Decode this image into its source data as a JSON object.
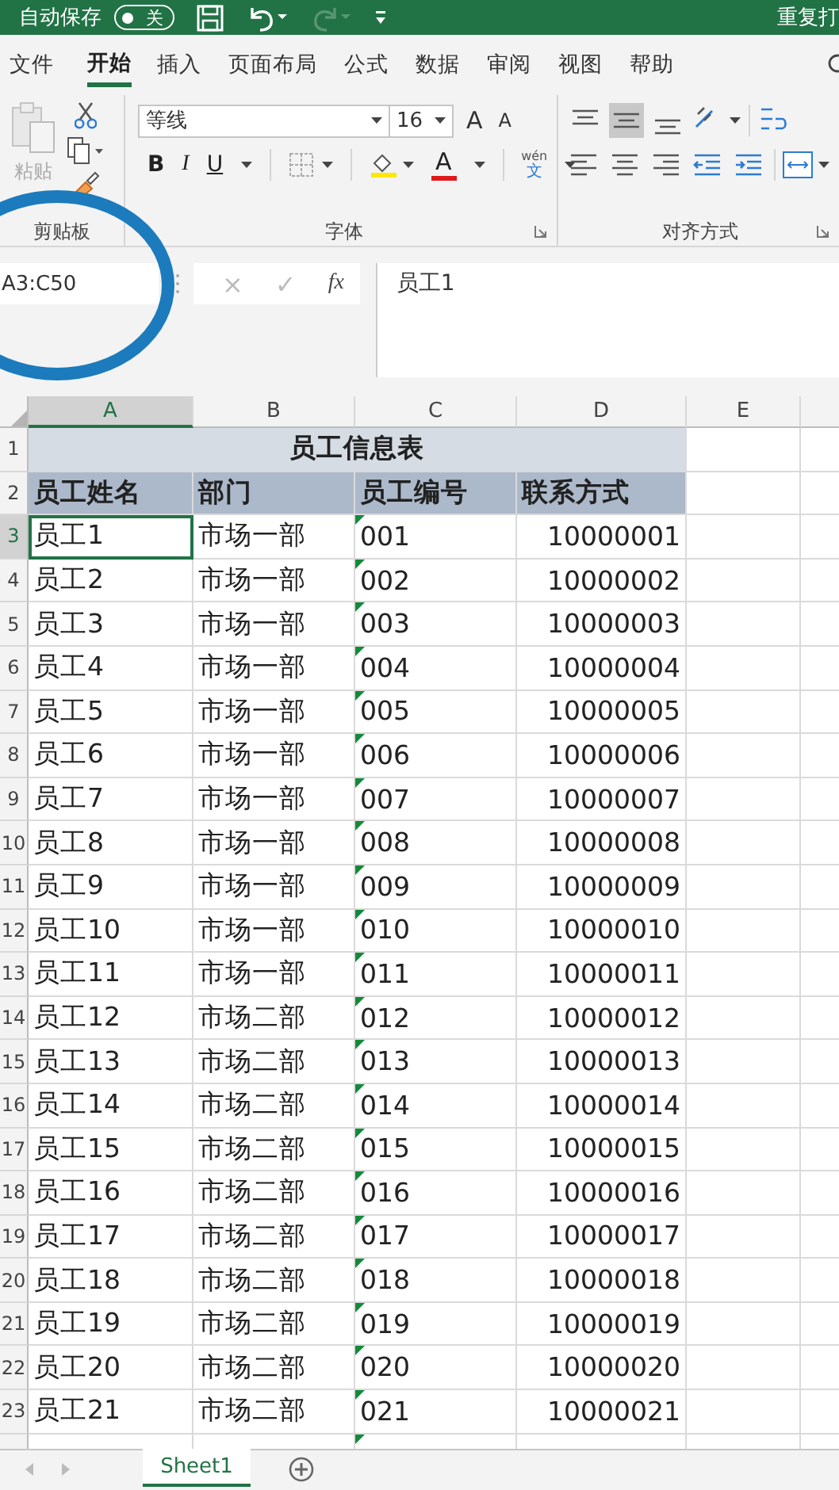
{
  "title_bar": {
    "autosave_label": "自动保存",
    "autosave_toggle": {
      "on": false,
      "label": "关"
    },
    "document_title": "重复打"
  },
  "ribbon_tabs": [
    {
      "label": "文件",
      "selected": false
    },
    {
      "label": "开始",
      "selected": true
    },
    {
      "label": "插入",
      "selected": false
    },
    {
      "label": "页面布局",
      "selected": false
    },
    {
      "label": "公式",
      "selected": false
    },
    {
      "label": "数据",
      "selected": false
    },
    {
      "label": "审阅",
      "selected": false
    },
    {
      "label": "视图",
      "selected": false
    },
    {
      "label": "帮助",
      "selected": false
    }
  ],
  "ribbon": {
    "paste_label": "粘贴",
    "font_name": "等线",
    "font_size": "16",
    "grow_label": "A",
    "shrink_label": "A",
    "bold_label": "B",
    "italic_label": "I",
    "underline_label": "U",
    "font_color_label": "A",
    "phonetic_top": "wén",
    "phonetic_bottom": "文",
    "groups": [
      "剪贴板",
      "字体",
      "对齐方式"
    ]
  },
  "formula_bar": {
    "name_box": "A3:C50",
    "cancel": "×",
    "enter": "✓",
    "fx": "fx",
    "value": "员工1"
  },
  "columns": [
    {
      "label": "A",
      "selected": true,
      "kind": "text",
      "error_marks": false
    },
    {
      "label": "B",
      "selected": false,
      "kind": "text",
      "error_marks": false
    },
    {
      "label": "C",
      "selected": false,
      "kind": "text",
      "error_marks": true
    },
    {
      "label": "D",
      "selected": false,
      "kind": "number",
      "error_marks": false
    },
    {
      "label": "E",
      "selected": false,
      "error_marks": false
    }
  ],
  "rows": [
    {
      "number": "1",
      "kind": "title",
      "text": "员工信息表",
      "selected": false
    },
    {
      "number": "2",
      "kind": "header",
      "cells": [
        "员工姓名",
        "部门",
        "员工编号",
        "联系方式"
      ],
      "selected": false
    },
    {
      "number": "3",
      "kind": "data",
      "cells": [
        "员工1",
        "市场一部",
        "001",
        "10000001"
      ],
      "selected": true
    },
    {
      "number": "4",
      "kind": "data",
      "cells": [
        "员工2",
        "市场一部",
        "002",
        "10000002"
      ],
      "selected": false
    },
    {
      "number": "5",
      "kind": "data",
      "cells": [
        "员工3",
        "市场一部",
        "003",
        "10000003"
      ],
      "selected": false
    },
    {
      "number": "6",
      "kind": "data",
      "cells": [
        "员工4",
        "市场一部",
        "004",
        "10000004"
      ],
      "selected": false
    },
    {
      "number": "7",
      "kind": "data",
      "cells": [
        "员工5",
        "市场一部",
        "005",
        "10000005"
      ],
      "selected": false
    },
    {
      "number": "8",
      "kind": "data",
      "cells": [
        "员工6",
        "市场一部",
        "006",
        "10000006"
      ],
      "selected": false
    },
    {
      "number": "9",
      "kind": "data",
      "cells": [
        "员工7",
        "市场一部",
        "007",
        "10000007"
      ],
      "selected": false
    },
    {
      "number": "10",
      "kind": "data",
      "cells": [
        "员工8",
        "市场一部",
        "008",
        "10000008"
      ],
      "selected": false
    },
    {
      "number": "11",
      "kind": "data",
      "cells": [
        "员工9",
        "市场一部",
        "009",
        "10000009"
      ],
      "selected": false
    },
    {
      "number": "12",
      "kind": "data",
      "cells": [
        "员工10",
        "市场一部",
        "010",
        "10000010"
      ],
      "selected": false
    },
    {
      "number": "13",
      "kind": "data",
      "cells": [
        "员工11",
        "市场一部",
        "011",
        "10000011"
      ],
      "selected": false
    },
    {
      "number": "14",
      "kind": "data",
      "cells": [
        "员工12",
        "市场二部",
        "012",
        "10000012"
      ],
      "selected": false
    },
    {
      "number": "15",
      "kind": "data",
      "cells": [
        "员工13",
        "市场二部",
        "013",
        "10000013"
      ],
      "selected": false
    },
    {
      "number": "16",
      "kind": "data",
      "cells": [
        "员工14",
        "市场二部",
        "014",
        "10000014"
      ],
      "selected": false
    },
    {
      "number": "17",
      "kind": "data",
      "cells": [
        "员工15",
        "市场二部",
        "015",
        "10000015"
      ],
      "selected": false
    },
    {
      "number": "18",
      "kind": "data",
      "cells": [
        "员工16",
        "市场二部",
        "016",
        "10000016"
      ],
      "selected": false
    },
    {
      "number": "19",
      "kind": "data",
      "cells": [
        "员工17",
        "市场二部",
        "017",
        "10000017"
      ],
      "selected": false
    },
    {
      "number": "20",
      "kind": "data",
      "cells": [
        "员工18",
        "市场二部",
        "018",
        "10000018"
      ],
      "selected": false
    },
    {
      "number": "21",
      "kind": "data",
      "cells": [
        "员工19",
        "市场二部",
        "019",
        "10000019"
      ],
      "selected": false
    },
    {
      "number": "22",
      "kind": "data",
      "cells": [
        "员工20",
        "市场二部",
        "020",
        "10000020"
      ],
      "selected": false
    },
    {
      "number": "23",
      "kind": "data",
      "cells": [
        "员工21",
        "市场二部",
        "021",
        "10000021"
      ],
      "selected": false
    }
  ],
  "sheet_tabs": [
    {
      "label": "Sheet1",
      "selected": true
    }
  ]
}
